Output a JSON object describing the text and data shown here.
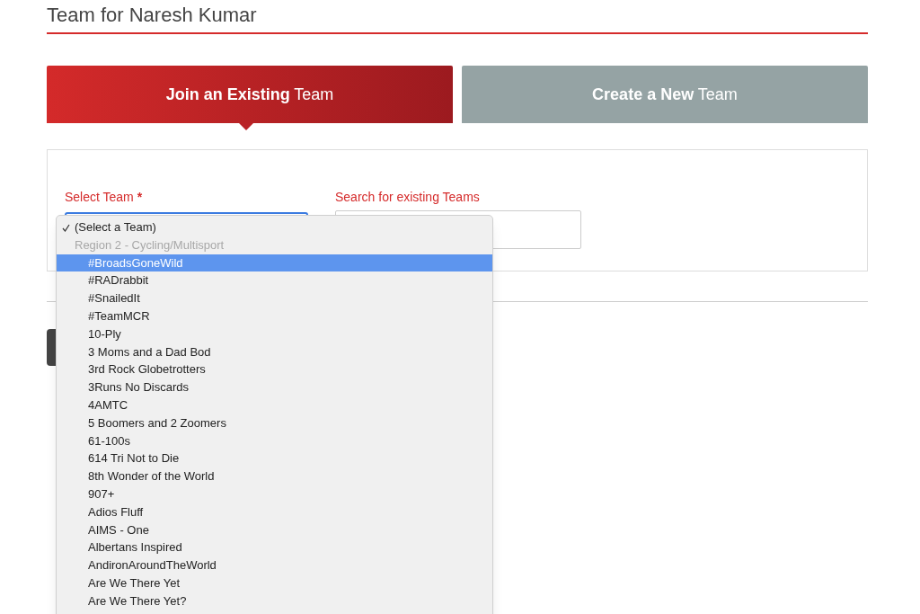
{
  "heading": "Team for Naresh Kumar",
  "tabs": [
    {
      "label": "**Join an Existing** Team",
      "selected": true
    },
    {
      "label": "**Create a New** Team",
      "selected": false
    }
  ],
  "form": {
    "select_label": "Select Team",
    "required_mark": "*",
    "search_label": "Search for existing Teams"
  },
  "dropdown": {
    "options": [
      {
        "kind": "option",
        "label": "(Select a Team)",
        "checked": true,
        "highlighted": false,
        "indented": false
      },
      {
        "kind": "group",
        "label": "Region 2 - Cycling/Multisport"
      },
      {
        "kind": "option",
        "label": "#BroadsGoneWild",
        "checked": false,
        "highlighted": true,
        "indented": true
      },
      {
        "kind": "option",
        "label": "#RADrabbit",
        "checked": false,
        "highlighted": false,
        "indented": true
      },
      {
        "kind": "option",
        "label": "#SnailedIt",
        "checked": false,
        "highlighted": false,
        "indented": true
      },
      {
        "kind": "option",
        "label": "#TeamMCR",
        "checked": false,
        "highlighted": false,
        "indented": true
      },
      {
        "kind": "option",
        "label": "10-Ply",
        "checked": false,
        "highlighted": false,
        "indented": true
      },
      {
        "kind": "option",
        "label": "3 Moms and a Dad Bod",
        "checked": false,
        "highlighted": false,
        "indented": true
      },
      {
        "kind": "option",
        "label": "3rd Rock Globetrotters",
        "checked": false,
        "highlighted": false,
        "indented": true
      },
      {
        "kind": "option",
        "label": "3Runs No Discards",
        "checked": false,
        "highlighted": false,
        "indented": true
      },
      {
        "kind": "option",
        "label": "4AMTC",
        "checked": false,
        "highlighted": false,
        "indented": true
      },
      {
        "kind": "option",
        "label": "5 Boomers and 2 Zoomers",
        "checked": false,
        "highlighted": false,
        "indented": true
      },
      {
        "kind": "option",
        "label": "61-100s",
        "checked": false,
        "highlighted": false,
        "indented": true
      },
      {
        "kind": "option",
        "label": "614 Tri Not to Die",
        "checked": false,
        "highlighted": false,
        "indented": true
      },
      {
        "kind": "option",
        "label": "8th Wonder of the World",
        "checked": false,
        "highlighted": false,
        "indented": true
      },
      {
        "kind": "option",
        "label": "907+",
        "checked": false,
        "highlighted": false,
        "indented": true
      },
      {
        "kind": "option",
        "label": "Adios Fluff",
        "checked": false,
        "highlighted": false,
        "indented": true
      },
      {
        "kind": "option",
        "label": "AIMS - One",
        "checked": false,
        "highlighted": false,
        "indented": true
      },
      {
        "kind": "option",
        "label": "Albertans Inspired",
        "checked": false,
        "highlighted": false,
        "indented": true
      },
      {
        "kind": "option",
        "label": "AndironAroundTheWorld",
        "checked": false,
        "highlighted": false,
        "indented": true
      },
      {
        "kind": "option",
        "label": "Are We There Yet",
        "checked": false,
        "highlighted": false,
        "indented": true
      },
      {
        "kind": "option",
        "label": "Are We There Yet?",
        "checked": false,
        "highlighted": false,
        "indented": true
      }
    ]
  }
}
